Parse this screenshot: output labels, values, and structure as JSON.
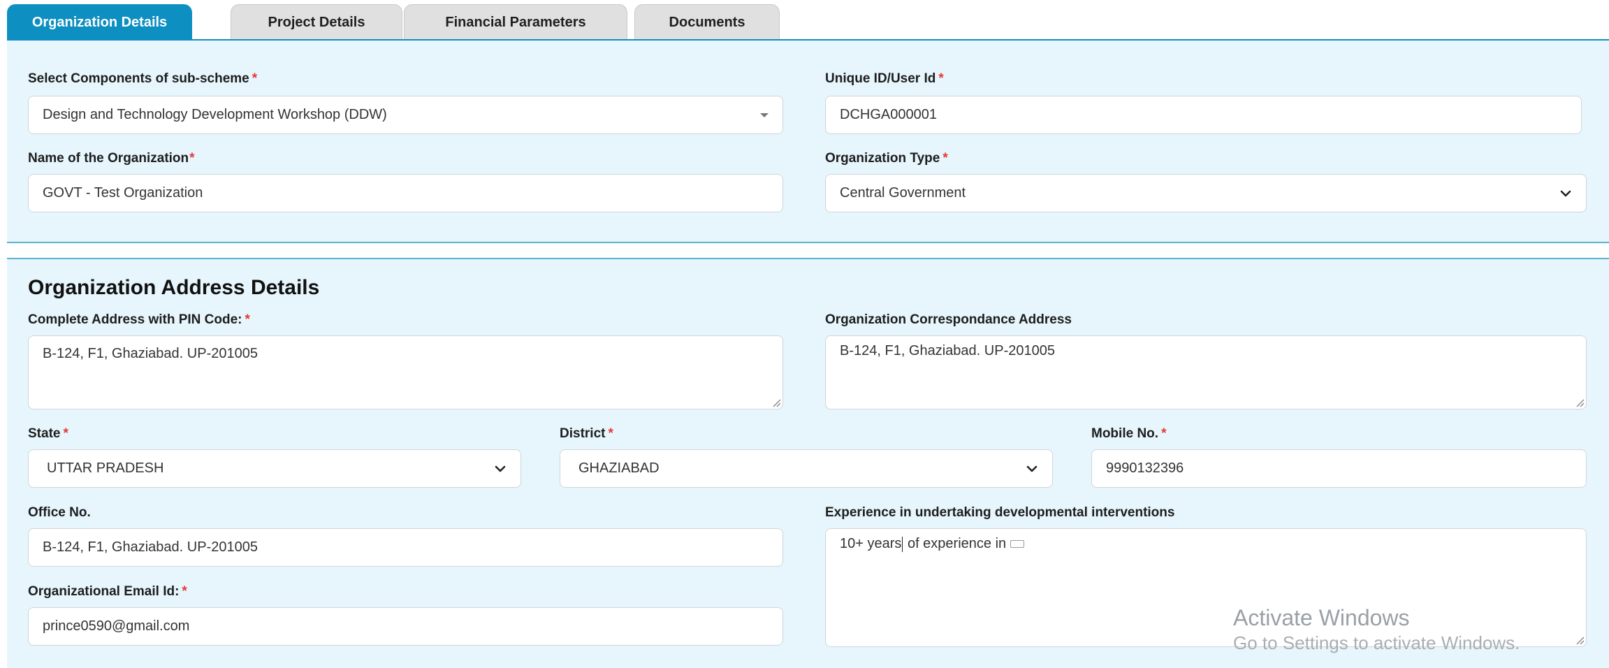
{
  "tabs": [
    {
      "label": "Organization Details",
      "active": true
    },
    {
      "label": "Project Details",
      "active": false
    },
    {
      "label": "Financial Parameters",
      "active": false
    },
    {
      "label": "Documents",
      "active": false
    }
  ],
  "colors": {
    "accent": "#0e8fc1",
    "section_bg": "#e6f6fc",
    "required": "#e53935"
  },
  "org_details": {
    "component_label": "Select Components of sub-scheme",
    "component_value": "Design and Technology Development Workshop (DDW)",
    "unique_id_label": "Unique ID/User Id",
    "unique_id_value": "DCHGA000001",
    "org_name_label": "Name of the Organization",
    "org_name_value": "GOVT - Test Organization",
    "org_type_label": "Organization Type",
    "org_type_value": "Central Government"
  },
  "address": {
    "title": "Organization Address Details",
    "complete_address_label": "Complete Address with PIN Code:",
    "complete_address_value": "B-124, F1, Ghaziabad. UP-201005",
    "correspondence_label": "Organization Correspondance Address",
    "correspondence_value": "B-124, F1, Ghaziabad. UP-201005",
    "state_label": "State",
    "state_value": "UTTAR PRADESH",
    "district_label": "District",
    "district_value": "GHAZIABAD",
    "mobile_label": "Mobile No.",
    "mobile_value": "9990132396",
    "office_label": "Office No.",
    "office_value": "B-124, F1, Ghaziabad. UP-201005",
    "experience_label": "Experience in undertaking developmental interventions",
    "experience_value_before_cursor": "10+ years",
    "experience_value_after_cursor": " of experience in",
    "email_label": "Organizational Email Id:",
    "email_value": "prince0590@gmail.com"
  },
  "required_marker": "*",
  "watermark": {
    "line1": "Activate Windows",
    "line2": "Go to Settings to activate Windows."
  }
}
